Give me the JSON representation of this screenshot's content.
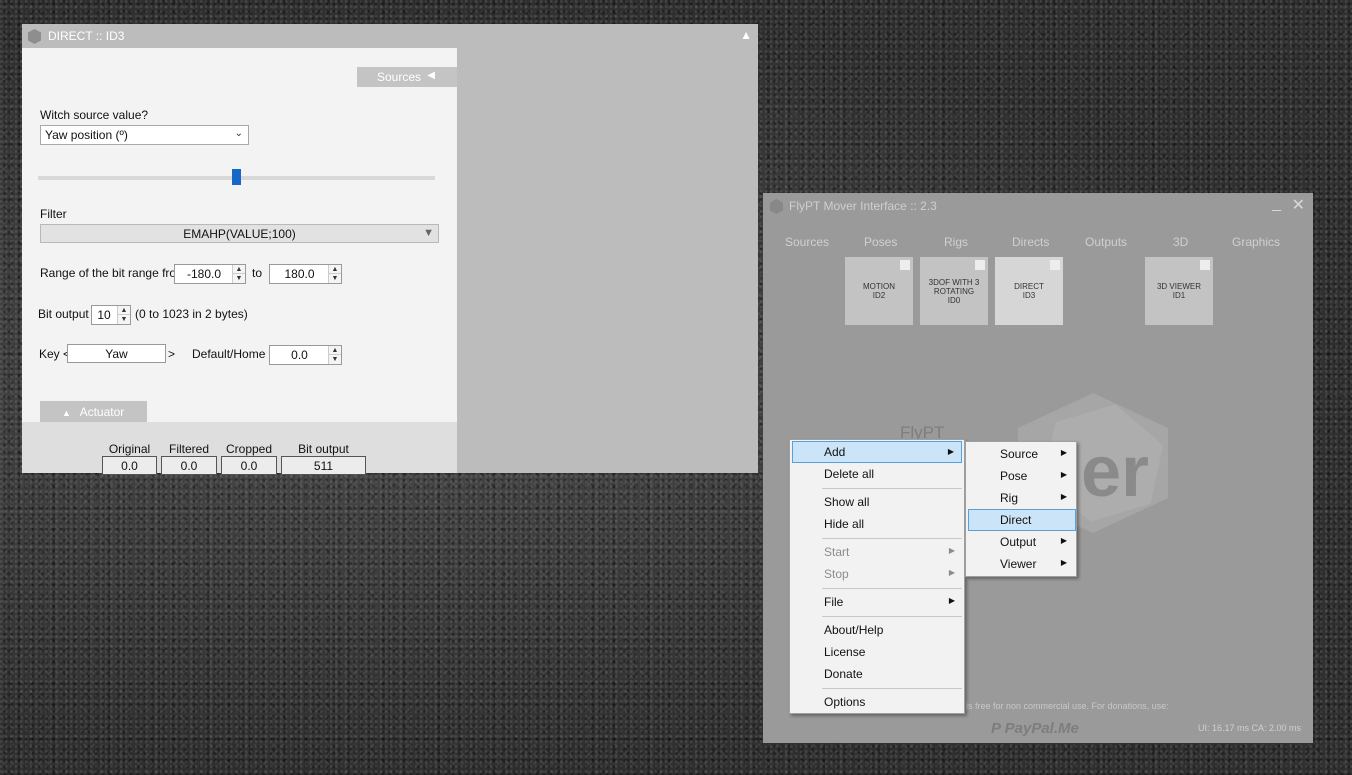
{
  "direct_window": {
    "title": "DIRECT :: ID3",
    "collapse_icon": "▲",
    "sources_tab": "Sources",
    "source_label": "Witch source value?",
    "source_value": "Yaw position (º)",
    "slider_fraction": 0.5,
    "filter_label": "Filter",
    "filter_value": "EMAHP(VALUE;100)",
    "range_label": "Range of the bit range from",
    "range_from": "-180.0",
    "range_to_label": "to",
    "range_to": "180.0",
    "bit_output_label": "Bit output",
    "bit_output_value": "10",
    "bit_output_note": "(0 to 1023 in 2 bytes)",
    "key_label": "Key <",
    "key_value": "Yaw",
    "key_close": ">",
    "default_label": "Default/Home",
    "default_value": "0.0",
    "actuator_tab": "Actuator",
    "outputs": {
      "original_label": "Original",
      "original_value": "0.0",
      "filtered_label": "Filtered",
      "filtered_value": "0.0",
      "cropped_label": "Cropped",
      "cropped_value": "0.0",
      "bit_output_label": "Bit output",
      "bit_output_value": "511"
    }
  },
  "flypt_window": {
    "title": "FlyPT Mover Interface :: 2.3",
    "tabs": [
      "Sources",
      "Poses",
      "Rigs",
      "Directs",
      "Outputs",
      "3D",
      "Graphics"
    ],
    "modules": [
      {
        "line1": "MOTION",
        "line2": "ID2",
        "line3": ""
      },
      {
        "line1": "3DOF WITH 3",
        "line2": "ROTATING",
        "line3": "ID0"
      },
      {
        "line1": "DIRECT",
        "line2": "ID3",
        "line3": ""
      },
      {
        "line1": "3D VIEWER",
        "line2": "ID1",
        "line3": ""
      }
    ],
    "logo_text": "FlyPT",
    "logo_tail": "er",
    "footer": "is free for non commercial use. For donations, use:",
    "paypal": "PayPal.Me",
    "timing": "UI: 16.17 ms   CA: 2.00 ms"
  },
  "context_menu": {
    "add": "Add",
    "delete_all": "Delete all",
    "show_all": "Show all",
    "hide_all": "Hide all",
    "start": "Start",
    "stop": "Stop",
    "file": "File",
    "about": "About/Help",
    "license": "License",
    "donate": "Donate",
    "options": "Options"
  },
  "add_submenu": {
    "source": "Source",
    "pose": "Pose",
    "rig": "Rig",
    "direct": "Direct",
    "output": "Output",
    "viewer": "Viewer"
  },
  "colors": {
    "accent": "#1767c6",
    "menu_highlight": "#cce4f7",
    "menu_highlight_border": "#5a9fd8"
  }
}
